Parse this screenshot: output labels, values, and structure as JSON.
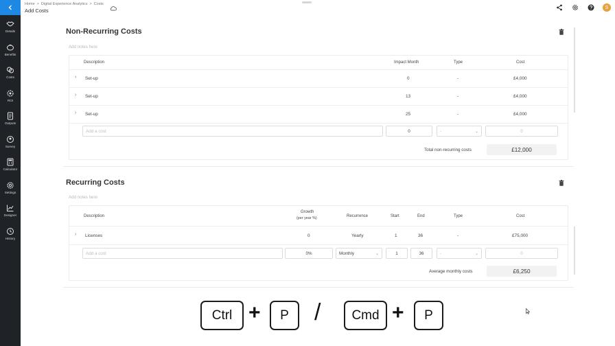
{
  "sidebar": {
    "items": [
      {
        "label": "Details",
        "icon": "handshake-icon"
      },
      {
        "label": "Benefits",
        "icon": "piggy-bank-icon"
      },
      {
        "label": "Costs",
        "icon": "coins-icon"
      },
      {
        "label": "ROI",
        "icon": "gear-icon"
      },
      {
        "label": "Outputs",
        "icon": "document-icon"
      },
      {
        "label": "Survey",
        "icon": "users-icon"
      },
      {
        "label": "Calculator",
        "icon": "calculator-icon"
      },
      {
        "label": "Settings",
        "icon": "gear-icon"
      },
      {
        "label": "Designer",
        "icon": "chart-icon"
      },
      {
        "label": "History",
        "icon": "history-icon"
      }
    ]
  },
  "header": {
    "breadcrumbs": [
      "Home",
      ">",
      "Digital Experience Analytics",
      ">",
      "Costs"
    ],
    "title": "Add Costs",
    "avatar_letter": "S"
  },
  "non_recurring": {
    "title": "Non-Recurring Costs",
    "notes_placeholder": "Add notes here",
    "columns": {
      "description": "Description",
      "impact_month": "Impact Month",
      "type": "Type",
      "cost": "Cost"
    },
    "rows": [
      {
        "description": "Set-up",
        "impact_month": "0",
        "type": "-",
        "cost": "£4,000"
      },
      {
        "description": "Set-up",
        "impact_month": "13",
        "type": "-",
        "cost": "£4,000"
      },
      {
        "description": "Set-up",
        "impact_month": "25",
        "type": "-",
        "cost": "£4,000"
      }
    ],
    "new_row": {
      "description_placeholder": "Add a cost",
      "impact_month": "0",
      "type": "-",
      "cost_placeholder": "0"
    },
    "total_label": "Total non-recurring costs",
    "total_value": "£12,000"
  },
  "recurring": {
    "title": "Recurring Costs",
    "notes_placeholder": "Add notes here",
    "columns": {
      "description": "Description",
      "growth_line1": "Growth",
      "growth_line2": "(per year %)",
      "recurrence": "Recurrence",
      "start": "Start",
      "end": "End",
      "type": "Type",
      "cost": "Cost"
    },
    "rows": [
      {
        "description": "Licenses",
        "growth": "0",
        "recurrence": "Yearly",
        "start": "1",
        "end": "36",
        "type": "-",
        "cost": "£75,000"
      }
    ],
    "new_row": {
      "description_placeholder": "Add a cost",
      "growth": "0%",
      "recurrence": "Monthly",
      "start": "1",
      "end": "36",
      "type": "-",
      "cost_placeholder": "0"
    },
    "total_label": "Average monthly costs",
    "total_value": "£6,250"
  },
  "shortcut": {
    "ctrl": "Ctrl",
    "p1": "P",
    "plus": "+",
    "slash": "/",
    "cmd": "Cmd",
    "p2": "P"
  },
  "colors": {
    "sidebar_bg": "#1f2328",
    "accent": "#1e88e5",
    "avatar": "#e6a23c"
  }
}
